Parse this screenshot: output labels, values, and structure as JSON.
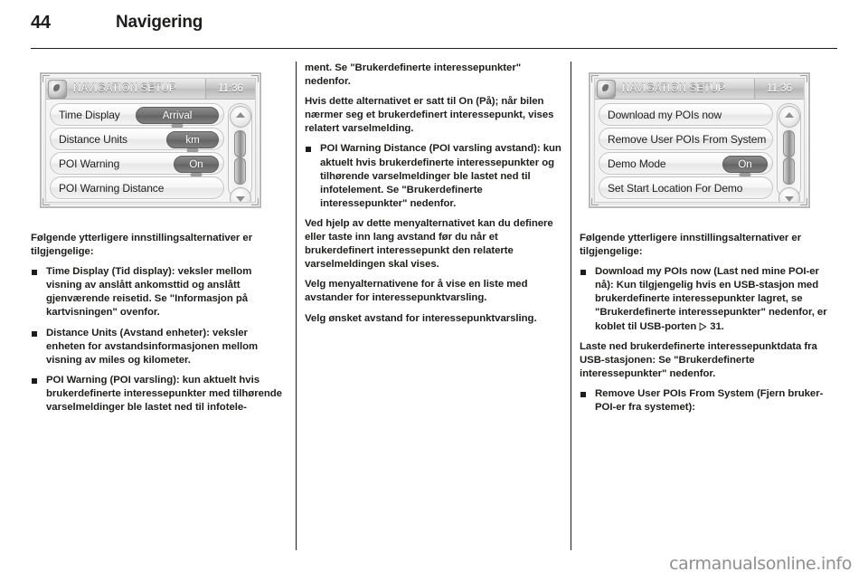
{
  "header": {
    "page_number": "44",
    "title": "Navigering"
  },
  "figures": [
    {
      "name": "navigation-setup-screen-1",
      "titlebar": {
        "icon": "navigation-disc-icon",
        "title": "NAVIGATION SETUP",
        "clock": "11:36"
      },
      "rows": [
        {
          "label": "Time Display",
          "value": "Arrival"
        },
        {
          "label": "Distance Units",
          "value": "km"
        },
        {
          "label": "POI Warning",
          "value": "On"
        },
        {
          "label": "POI Warning Distance",
          "value": ""
        }
      ],
      "scrollbar": {
        "up_icon": "chevron-up-icon",
        "down_icon": "chevron-down-icon"
      }
    },
    {
      "name": "navigation-setup-screen-2",
      "titlebar": {
        "icon": "navigation-disc-icon",
        "title": "NAVIGATION SETUP",
        "clock": "11:36"
      },
      "rows": [
        {
          "label": "Download my POIs now",
          "value": ""
        },
        {
          "label": "Remove User POIs From System",
          "value": ""
        },
        {
          "label": "Demo Mode",
          "value": "On"
        },
        {
          "label": "Set Start Location For Demo",
          "value": ""
        }
      ],
      "scrollbar": {
        "up_icon": "chevron-up-icon",
        "down_icon": "chevron-down-icon"
      }
    }
  ],
  "column_1": {
    "intro": "Følgende ytterligere innstillingsalternativer er tilgjengelige:",
    "bullets": [
      "Time Display (Tid display): veksler mellom visning av anslått ankomsttid og anslått gjenværende reisetid. Se \"Informasjon på kartvisningen\" ovenfor.",
      "Distance Units (Avstand enheter): veksler enheten for avstandsinformasjonen mellom visning av miles og kilometer.",
      "POI Warning (POI varsling): kun aktuelt hvis brukerdefinerte interessepunkter med tilhørende varselmeldinger ble lastet ned til infotele-"
    ]
  },
  "column_2": {
    "paragraphs": [
      "ment. Se \"Brukerdefinerte interessepunkter\" nedenfor.",
      "Hvis dette alternativet er satt til On (På); når bilen nærmer seg et brukerdefinert interessepunkt, vises relatert varselmelding."
    ],
    "bullets": [
      "POI Warning Distance (POI varsling avstand): kun aktuelt hvis brukerdefinerte interessepunkter og tilhørende varselmeldinger ble lastet ned til infotelement. Se \"Brukerdefinerte interessepunkter\" nedenfor."
    ],
    "paragraphs_after": [
      "Ved hjelp av dette menyalternativet kan du definere eller taste inn lang avstand før du når et brukerdefinert interessepunkt den relaterte varselmeldingen skal vises.",
      "Velg menyalternativene for å vise en liste med avstander for interessepunktvarsling.",
      "Velg ønsket avstand for interessepunktvarsling."
    ]
  },
  "column_3": {
    "intro": "Følgende ytterligere innstillingsalternativer er tilgjengelige:",
    "bullets": [
      "Download my POIs now (Last ned mine POI-er nå): Kun tilgjengelig hvis en USB-stasjon med brukerdefinerte interessepunkter lagret, se \"Brukerdefinerte interessepunkter\" nedenfor, er koblet til USB-porten",
      "Remove User POIs From System (Fjern bruker-POI-er fra systemet):"
    ],
    "page_ref": "31",
    "page_ref_icon": "page-reference-arrow",
    "paragraph": "Laste ned brukerdefinerte interessepunktdata fra USB-stasjonen: Se \"Brukerdefinerte interessepunkter\" nedenfor."
  },
  "watermark": "carmanualsonline.info"
}
